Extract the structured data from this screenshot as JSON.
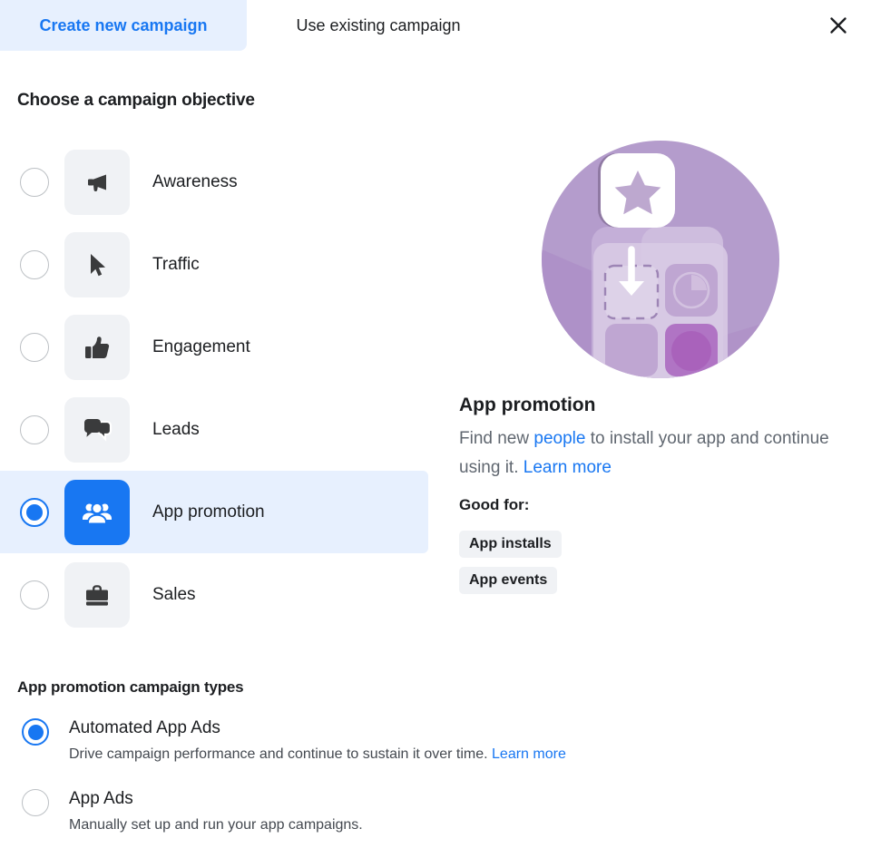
{
  "tabs": [
    {
      "label": "Create new campaign",
      "active": true
    },
    {
      "label": "Use existing campaign",
      "active": false
    }
  ],
  "close_label": "✕",
  "objective_section": {
    "title": "Choose a campaign objective",
    "items": [
      {
        "label": "Awareness",
        "icon": "megaphone-icon",
        "selected": false
      },
      {
        "label": "Traffic",
        "icon": "cursor-icon",
        "selected": false
      },
      {
        "label": "Engagement",
        "icon": "thumbs-up-icon",
        "selected": false
      },
      {
        "label": "Leads",
        "icon": "chat-bubbles-icon",
        "selected": false
      },
      {
        "label": "App promotion",
        "icon": "people-group-icon",
        "selected": true
      },
      {
        "label": "Sales",
        "icon": "briefcase-icon",
        "selected": false
      }
    ]
  },
  "detail": {
    "illustration": "app-install-illustration",
    "title": "App promotion",
    "desc_part1": "Find new ",
    "desc_link1": "people",
    "desc_part2": " to install your app and continue using it. ",
    "desc_link2": "Learn more",
    "good_for_label": "Good for:",
    "chips": [
      "App installs",
      "App events"
    ]
  },
  "campaign_types": {
    "title": "App promotion campaign types",
    "items": [
      {
        "label": "Automated App Ads",
        "desc": "Drive campaign performance and continue to sustain it over time. ",
        "link": "Learn more",
        "selected": true
      },
      {
        "label": "App Ads",
        "desc": "Manually set up and run your app campaigns.",
        "link": "",
        "selected": false
      }
    ]
  },
  "colors": {
    "accent_blue": "#1877f2",
    "selected_row_bg": "#e7f0fe",
    "tile_bg": "#f0f2f5",
    "text_primary": "#1c1e21",
    "text_secondary": "#606770",
    "illustration_purple": "#b49ccc"
  }
}
